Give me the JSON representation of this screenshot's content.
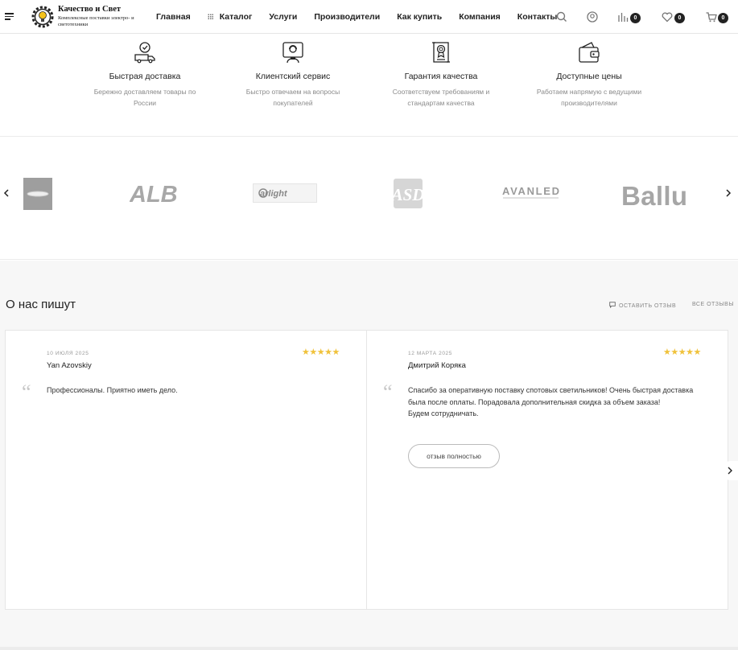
{
  "header": {
    "logo_title": "Качество и Свет",
    "logo_subtitle": "Комплексные поставки электро- и светотехники",
    "nav": [
      {
        "label": "Главная"
      },
      {
        "label": "Каталог"
      },
      {
        "label": "Услуги"
      },
      {
        "label": "Производители"
      },
      {
        "label": "Как купить"
      },
      {
        "label": "Компания"
      },
      {
        "label": "Контакты"
      }
    ],
    "compare_count": "0",
    "favorites_count": "0",
    "cart_count": "0"
  },
  "features": [
    {
      "icon": "delivery-van-icon",
      "title": "Быстрая доставка",
      "desc": "Бережно доставляем товары по России"
    },
    {
      "icon": "customer-service-icon",
      "title": "Клиентский сервис",
      "desc": "Быстро отвечаем на вопросы покупателей"
    },
    {
      "icon": "quality-certificate-icon",
      "title": "Гарантия качества",
      "desc": "Соответствуем требованиям и стандартам качества"
    },
    {
      "icon": "wallet-icon",
      "title": "Доступные цены",
      "desc": "Работаем напрямую с ведущими производителями"
    }
  ],
  "brands": [
    {
      "name": "ALB"
    },
    {
      "name": "arlight"
    },
    {
      "name": "ASD"
    },
    {
      "name": "AVANLED"
    },
    {
      "name": "Ballu"
    }
  ],
  "reviews_section": {
    "title": "О нас пишут",
    "leave_review": "оставить отзыв",
    "all_reviews": "все отзывы",
    "items": [
      {
        "date": "10 июля 2025",
        "author": "Yan Azovskiy",
        "rating": 5,
        "stars": "★★★★★",
        "text": "Профессионалы. Приятно иметь дело."
      },
      {
        "date": "12 марта 2025",
        "author": "Дмитрий Коряка",
        "rating": 5,
        "stars": "★★★★★",
        "text": "Спасибо за оперативную поставку спотовых светильников! Очень быстрая доставка была после оплаты. Порадовала дополнительная скидка за объем заказа!\nБудем сотрудничать.",
        "more_label": "отзыв полностью"
      }
    ]
  },
  "colors": {
    "accent_stars": "#f0c23b",
    "badge": "#222222",
    "section_bg": "#f7f7f7"
  }
}
